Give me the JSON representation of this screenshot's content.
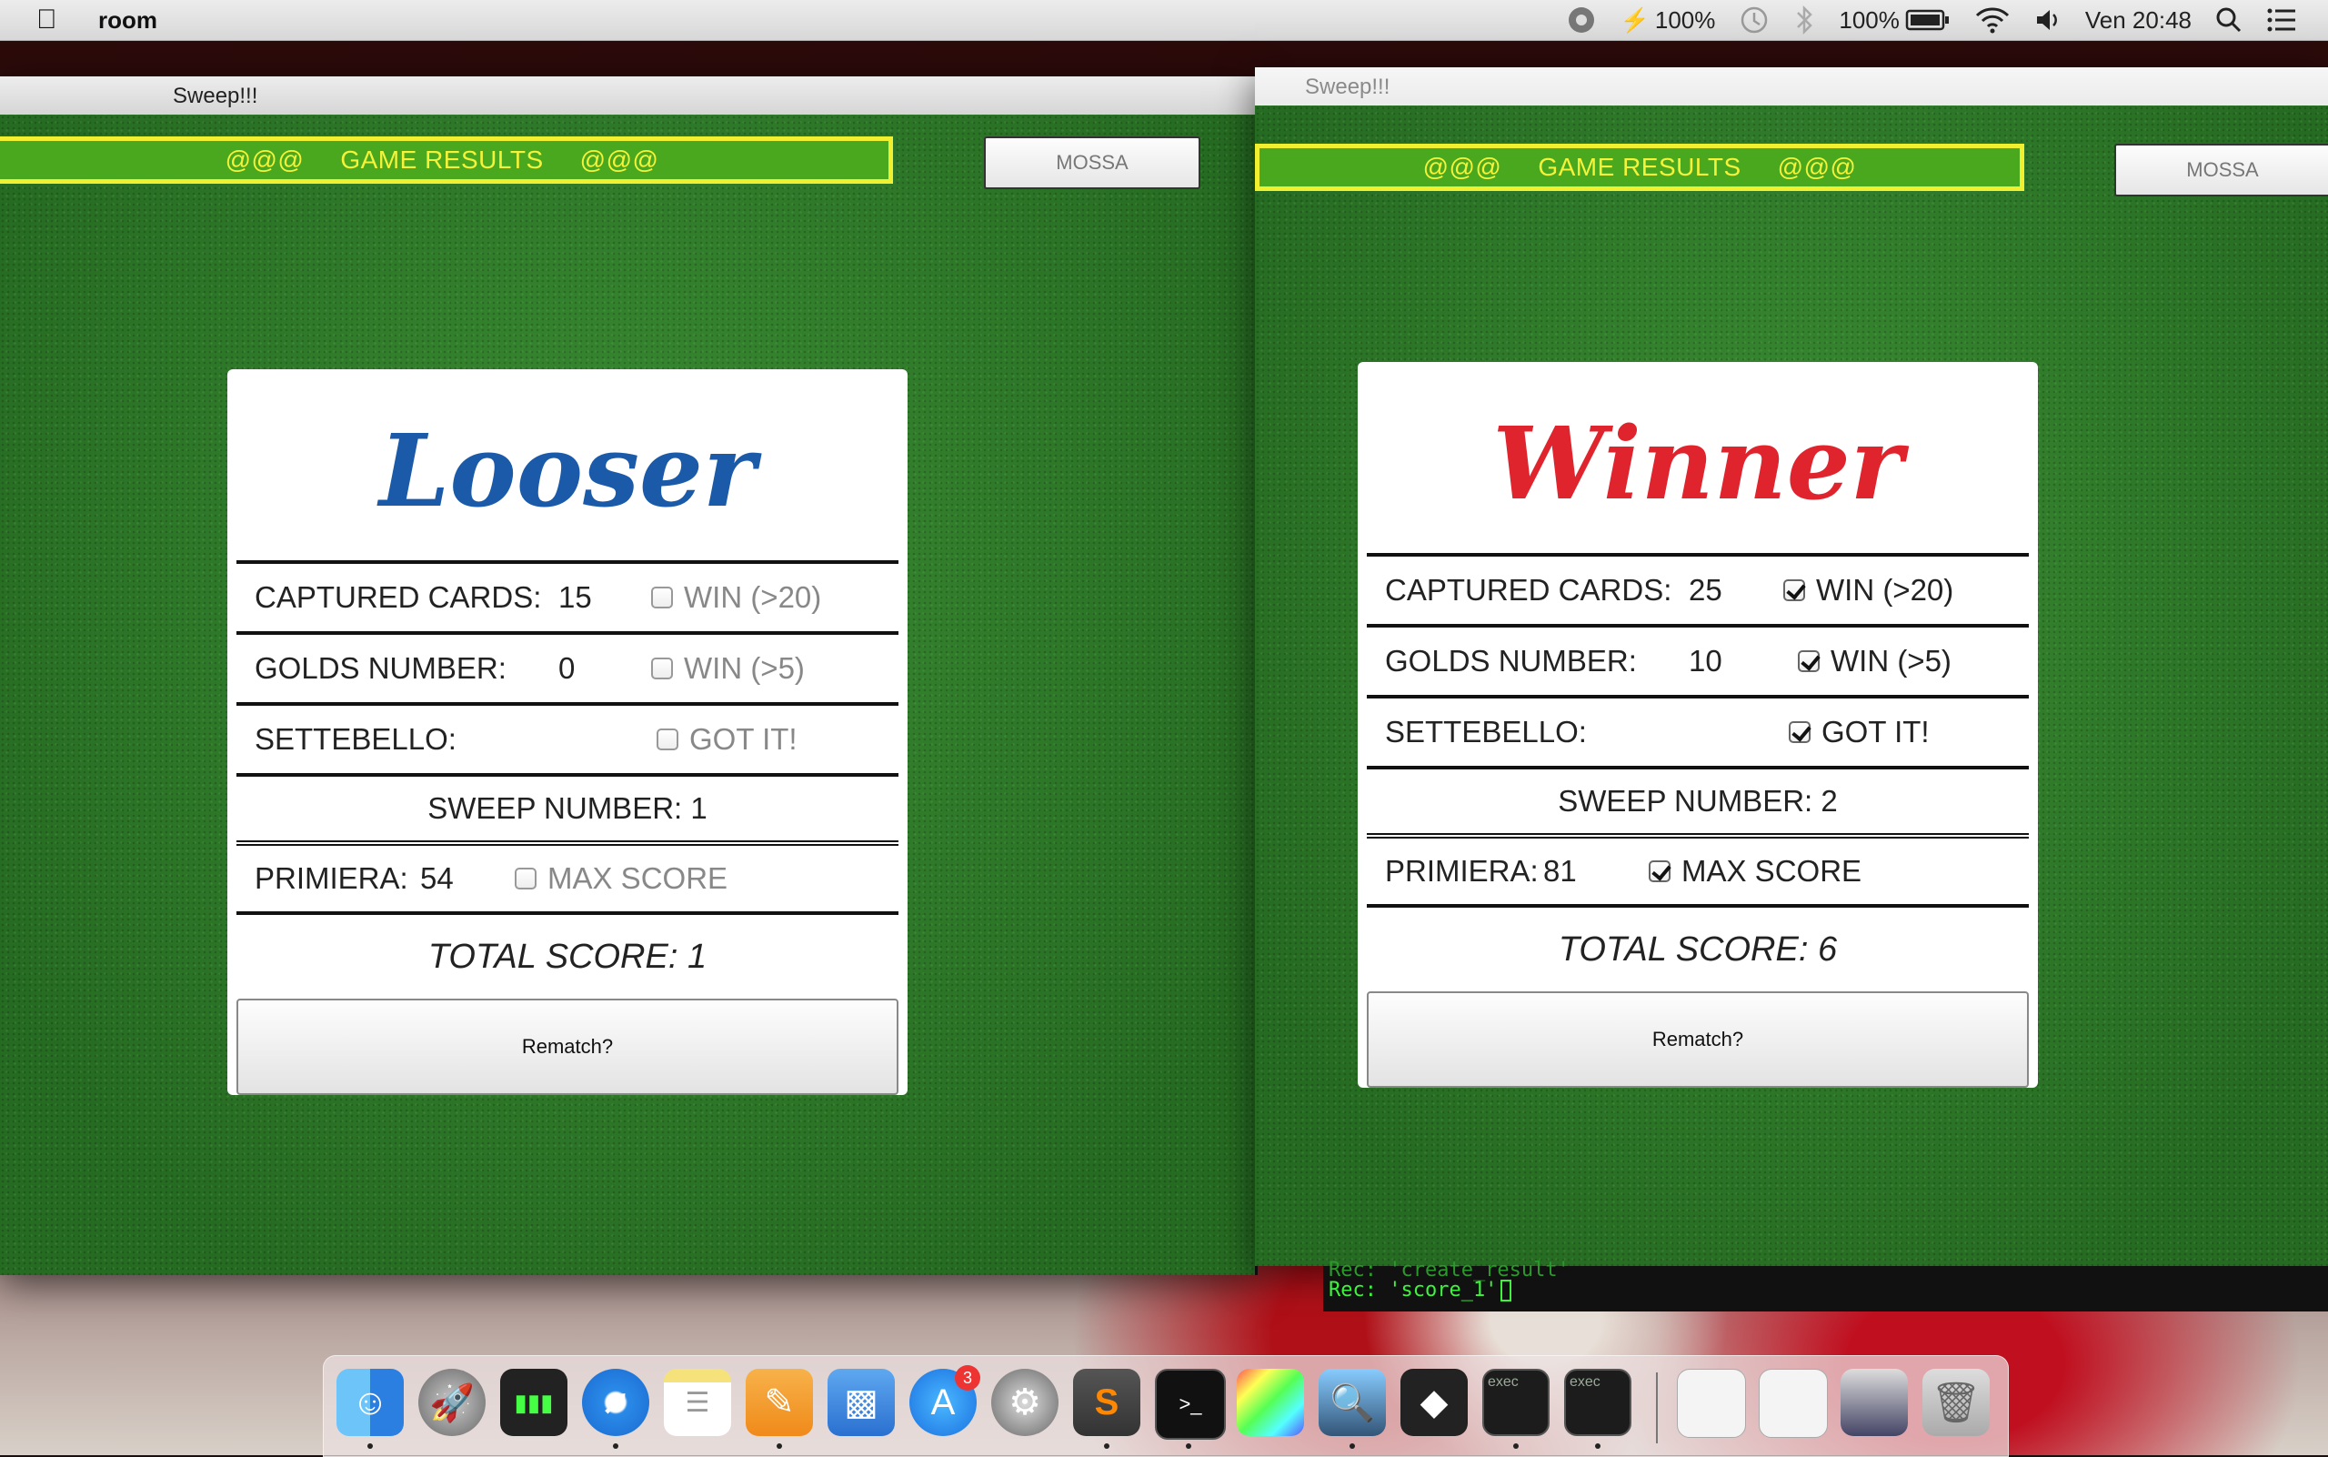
{
  "menubar": {
    "app_name": "room",
    "battery_charge_label": "100%",
    "battery_label": "100%",
    "datetime": "Ven 20:48"
  },
  "windows": [
    {
      "title": "Sweep!!!",
      "banner": {
        "left": "@@@",
        "text": "GAME RESULTS",
        "right": "@@@"
      },
      "mossa_label": "MOSSA",
      "result_logo": "Looser",
      "result_color": "#1a5aa8",
      "rows": {
        "captured_cards": {
          "label": "CAPTURED CARDS:",
          "value": "15",
          "check_label": "WIN (>20)",
          "checked": false
        },
        "golds_number": {
          "label": "GOLDS NUMBER:",
          "value": "0",
          "check_label": "WIN (>5)",
          "checked": false
        },
        "settebello": {
          "label": "SETTEBELLO:",
          "check_label": "GOT IT!",
          "checked": false
        },
        "sweep_number": "SWEEP NUMBER: 1",
        "primiera": {
          "label": "PRIMIERA:",
          "value": "54",
          "check_label": "MAX SCORE",
          "checked": false
        }
      },
      "total_score": "TOTAL SCORE: 1",
      "rematch_label": "Rematch?"
    },
    {
      "title": "Sweep!!!",
      "banner": {
        "left": "@@@",
        "text": "GAME RESULTS",
        "right": "@@@"
      },
      "mossa_label": "MOSSA",
      "result_logo": "Winner",
      "result_color": "#e0242e",
      "rows": {
        "captured_cards": {
          "label": "CAPTURED CARDS:",
          "value": "25",
          "check_label": "WIN (>20)",
          "checked": true
        },
        "golds_number": {
          "label": "GOLDS NUMBER:",
          "value": "10",
          "check_label": "WIN (>5)",
          "checked": true
        },
        "settebello": {
          "label": "SETTEBELLO:",
          "check_label": "GOT IT!",
          "checked": true
        },
        "sweep_number": "SWEEP NUMBER: 2",
        "primiera": {
          "label": "PRIMIERA:",
          "value": "81",
          "check_label": "MAX SCORE",
          "checked": true
        }
      },
      "total_score": "TOTAL SCORE: 6",
      "rematch_label": "Rematch?"
    }
  ],
  "terminal": {
    "line_partial": "Rec: 'create_result'",
    "line": "Rec: 'score_1'"
  },
  "dock": {
    "items": [
      "finder",
      "launchpad",
      "battery-monitor",
      "safari",
      "notes",
      "pages",
      "keynote",
      "app-store",
      "system-preferences",
      "sublime-text",
      "terminal",
      "color-picker",
      "preview",
      "unity",
      "exec-terminal",
      "exec-terminal",
      "document",
      "document",
      "screenshot",
      "trash"
    ],
    "app_store_badge": "3",
    "exec_label": "exec"
  }
}
